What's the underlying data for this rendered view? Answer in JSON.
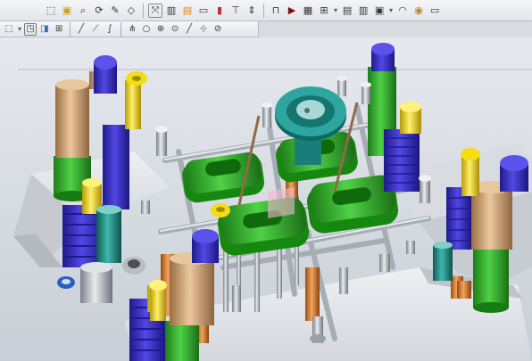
{
  "toolbar_top": {
    "icons": [
      "select-icon",
      "fit-icon",
      "zoom-icon",
      "rotate-icon",
      "sketch-icon",
      "feature-icon",
      "mirror-icon",
      "edit-icon",
      "layer-icon",
      "view-icon",
      "color-icon",
      "section-icon",
      "stretch-icon",
      "weld-icon",
      "measure-icon",
      "part-icon",
      "assembly-icon",
      "drawing-icon",
      "render-icon",
      "settings-icon",
      "save-icon",
      "help-icon"
    ]
  },
  "toolbar_snap": {
    "icons": [
      "snap-icon",
      "view-cube-icon",
      "shade-icon",
      "grid-icon",
      "line-icon",
      "polyline-icon",
      "curve-icon",
      "trim-icon",
      "circle-icon",
      "center-icon",
      "point-icon",
      "tangent-icon",
      "snap-end-icon"
    ]
  },
  "colors": {
    "green": "#2fb52a",
    "blue": "#3a32c8",
    "tan": "#cfa57a",
    "yellow": "#f4dd13",
    "teal": "#1e8f86",
    "orange": "#e58a2c"
  }
}
